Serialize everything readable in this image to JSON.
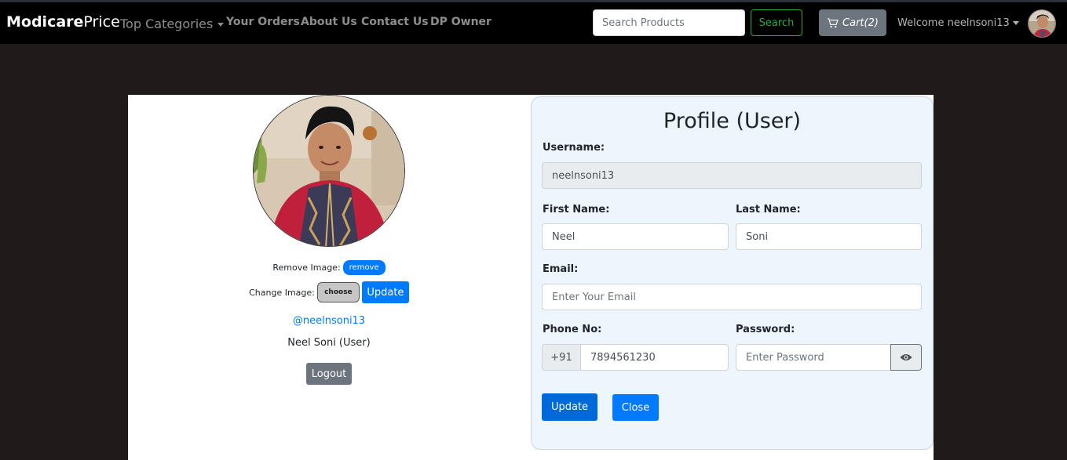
{
  "navbar": {
    "brand_bold": "Modicare",
    "brand_light": "Price",
    "categories_label": "Top Categories",
    "links": [
      "Your Orders",
      "About Us",
      "Contact Us",
      "DP Owner"
    ],
    "search_placeholder": "Search Products",
    "search_label": "Search",
    "cart_label": "Cart(2)",
    "welcome_label": "Welcome neelnsoni13",
    "cart_icon": "cart-icon"
  },
  "profile_side": {
    "remove_image_label": "Remove Image:",
    "remove_button": "remove",
    "change_image_label": "Change Image:",
    "choose_button": "choose",
    "update_image_button": "Update",
    "handle": "@neelnsoni13",
    "full_name": "Neel Soni (User)",
    "logout_button": "Logout"
  },
  "form": {
    "title": "Profile (User)",
    "username_label": "Username:",
    "username_value": "neelnsoni13",
    "first_name_label": "First Name:",
    "first_name_value": "Neel",
    "last_name_label": "Last Name:",
    "last_name_value": "Soni",
    "email_label": "Email:",
    "email_placeholder": "Enter Your Email",
    "phone_label": "Phone No:",
    "phone_prefix": "+91",
    "phone_value": "7894561230",
    "password_label": "Password:",
    "password_placeholder": "Enter Password",
    "password_toggle_icon": "eye-icon",
    "update_button": "Update",
    "close_button": "Close"
  },
  "colors": {
    "primary": "#007bff",
    "success": "#28a745",
    "secondary": "#6c757d",
    "navbar_bg": "#000000",
    "page_bg": "#201a1a",
    "form_bg": "#edf5fd"
  }
}
